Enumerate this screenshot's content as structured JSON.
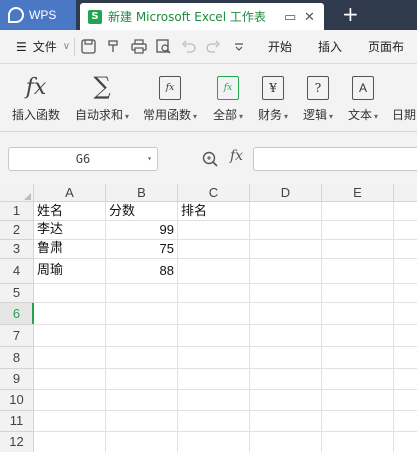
{
  "titlebar": {
    "app_tab_label": "WPS",
    "doc_tab_icon_letter": "S",
    "doc_tab_label": "新建 Microsoft Excel 工作表",
    "restore_symbol": "▭",
    "close_symbol": "✕",
    "new_tab_symbol": "+"
  },
  "menubar": {
    "hamburger_symbol": "☰",
    "file_label": "文件",
    "file_caret": "∨",
    "tabs": [
      "开始",
      "插入",
      "页面布"
    ]
  },
  "ribbon": {
    "buttons": [
      {
        "label": "插入函数",
        "icon": "fx-icon",
        "caret": ""
      },
      {
        "label": "自动求和",
        "icon": "sigma-icon",
        "caret": "▾"
      },
      {
        "label": "常用函数",
        "icon": "common-functions-icon",
        "caret": "▾"
      },
      {
        "label": "全部",
        "icon": "all-functions-icon",
        "caret": "▾"
      },
      {
        "label": "财务",
        "icon": "finance-icon",
        "caret": "▾"
      },
      {
        "label": "逻辑",
        "icon": "logic-icon",
        "caret": "▾"
      },
      {
        "label": "文本",
        "icon": "text-icon",
        "caret": "▾"
      },
      {
        "label": "日期",
        "icon": "date-icon",
        "caret": ""
      }
    ],
    "fx_glyph": "fx",
    "sigma_glyph": "∑",
    "finance_glyph": "¥",
    "logic_glyph": "?",
    "text_glyph": "A"
  },
  "formulabar": {
    "cell_reference": "G6",
    "name_caret": "▾",
    "fx_glyph": "fx",
    "formula_value": ""
  },
  "sheet": {
    "columns": [
      "A",
      "B",
      "C",
      "D",
      "E"
    ],
    "rows": [
      "1",
      "2",
      "3",
      "4",
      "5",
      "6",
      "7",
      "8",
      "9",
      "10",
      "11",
      "12"
    ],
    "active_row": "6",
    "cells": {
      "A1": "姓名",
      "B1": "分数",
      "C1": "排名",
      "A2": "李达",
      "B2": "99",
      "A3": "鲁肃",
      "B3": "75",
      "A4": "周瑜",
      "B4": "88"
    }
  },
  "colors": {
    "accent_green": "#23a550",
    "titlebar_bg": "#2f3a4d",
    "wps_tab_bg": "#4a78c4"
  }
}
